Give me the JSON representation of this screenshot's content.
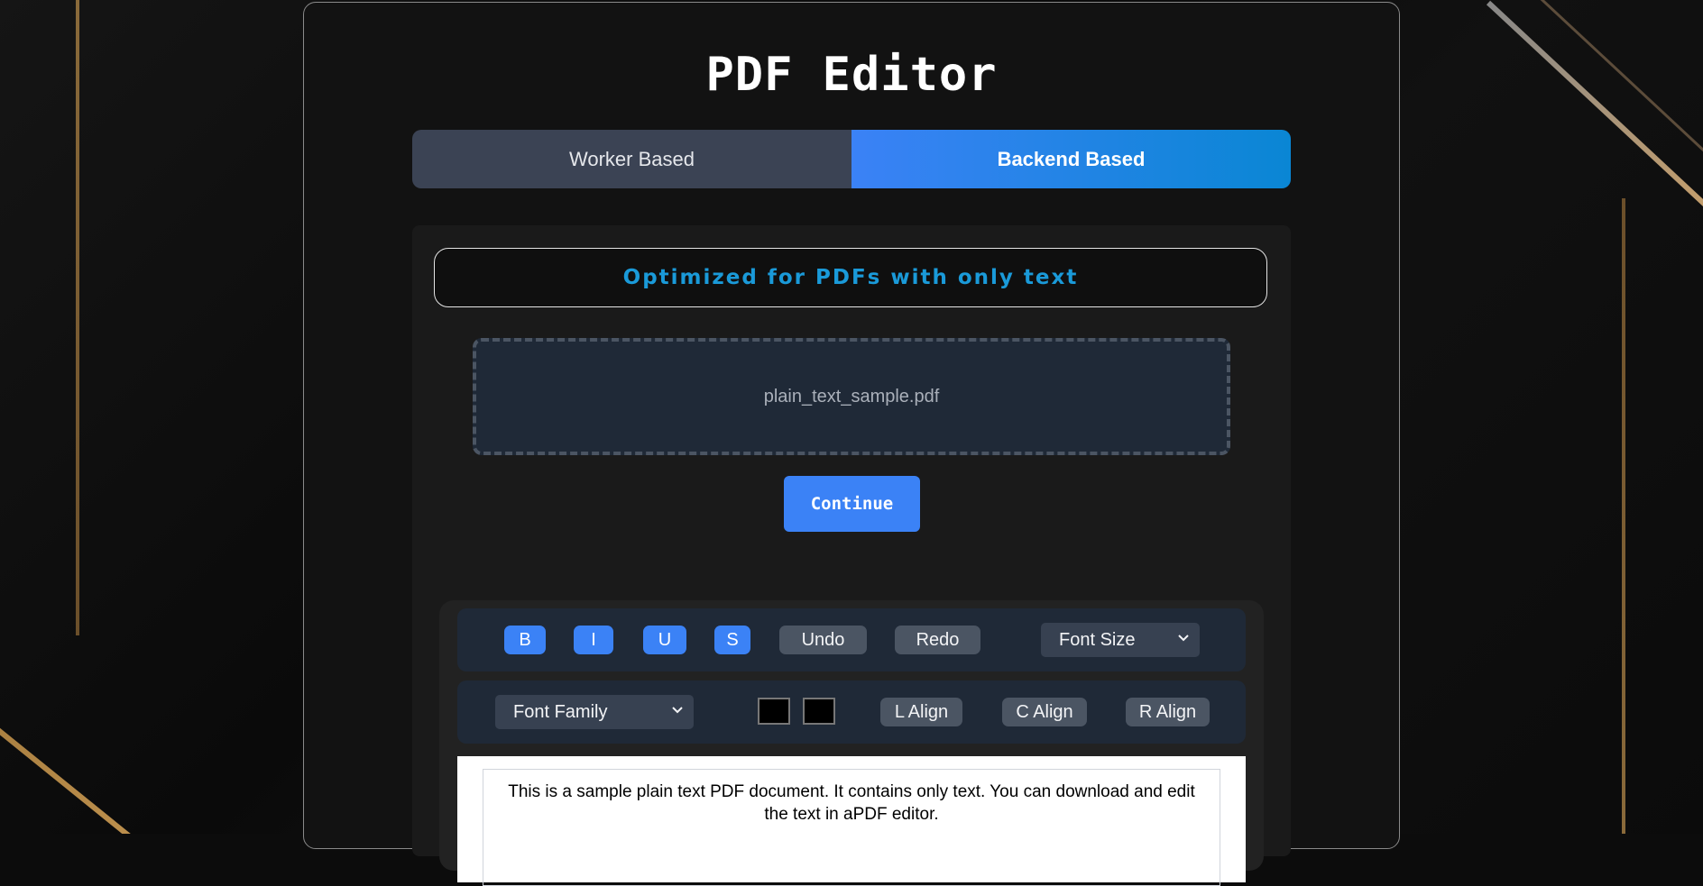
{
  "app": {
    "title": "PDF Editor"
  },
  "tabs": [
    {
      "label": "Worker Based",
      "active": false
    },
    {
      "label": "Backend Based",
      "active": true
    }
  ],
  "banner": {
    "text": "Optimized for PDFs with only text"
  },
  "upload": {
    "filename": "plain_text_sample.pdf"
  },
  "continue_label": "Continue",
  "toolbar_top": {
    "bold": "B",
    "italic": "I",
    "underline": "U",
    "strike": "S",
    "undo": "Undo",
    "redo": "Redo",
    "font_size": "Font Size"
  },
  "toolbar_bottom": {
    "font_family": "Font Family",
    "text_color": "#000000",
    "highlight_color": "#000000",
    "left_align": "L Align",
    "center_align": "C Align",
    "right_align": "R Align"
  },
  "document": {
    "text": "This is a sample plain text PDF document. It contains only text. You can download and edit the text in aPDF editor."
  },
  "colors": {
    "accent": "#3b82f6",
    "banner_text": "#1a9ad9",
    "background": "#0c0c0c"
  }
}
